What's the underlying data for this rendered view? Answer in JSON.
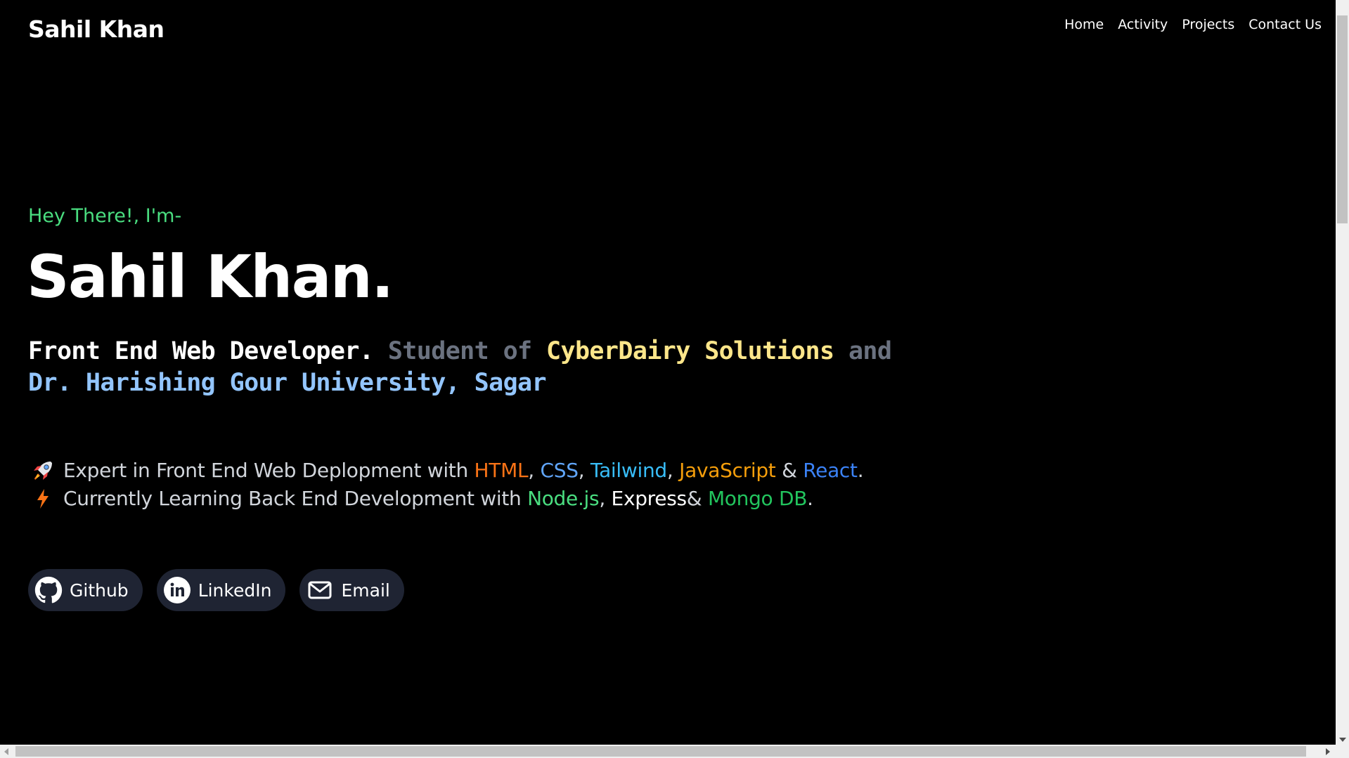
{
  "header": {
    "brand": "Sahil Khan",
    "nav": [
      "Home",
      "Activity",
      "Projects",
      "Contact Us"
    ]
  },
  "hero": {
    "greeting": "Hey There!, I'm-",
    "name": "Sahil Khan.",
    "role": {
      "title": "Front End Web Developer.",
      "student_of": "Student of",
      "company": "CyberDairy Solutions",
      "and": "and",
      "university": "Dr. Harishing Gour University, Sagar"
    }
  },
  "features": {
    "expert": {
      "emoji": "rocket-icon",
      "prefix": "Expert in Front End Web Deplopment with",
      "html": "HTML",
      "css": "CSS",
      "tailwind": "Tailwind",
      "javascript": "JavaScript",
      "amp": "&",
      "react": "React",
      "comma": ",",
      "period": "."
    },
    "learning": {
      "emoji": "lightning-icon",
      "prefix": "Currently Learning Back End Development with",
      "node": "Node.js",
      "express": "Express",
      "amp": "&",
      "mongo": "Mongo DB",
      "comma": ",",
      "period": "."
    }
  },
  "links": [
    {
      "label": "Github",
      "icon": "github-icon"
    },
    {
      "label": "LinkedIn",
      "icon": "linkedin-icon"
    },
    {
      "label": "Email",
      "icon": "mail-icon"
    }
  ],
  "colors": {
    "background": "#000000",
    "greeting": "#4ade80",
    "pill": "#1f2433",
    "html": "#f97316",
    "css": "#60a5fa",
    "tailwind": "#38bdf8",
    "javascript": "#f59e0b",
    "react": "#3b82f6",
    "node": "#4ade80",
    "mongo": "#22c55e",
    "company": "#fde68a",
    "university": "#93c5fd"
  }
}
